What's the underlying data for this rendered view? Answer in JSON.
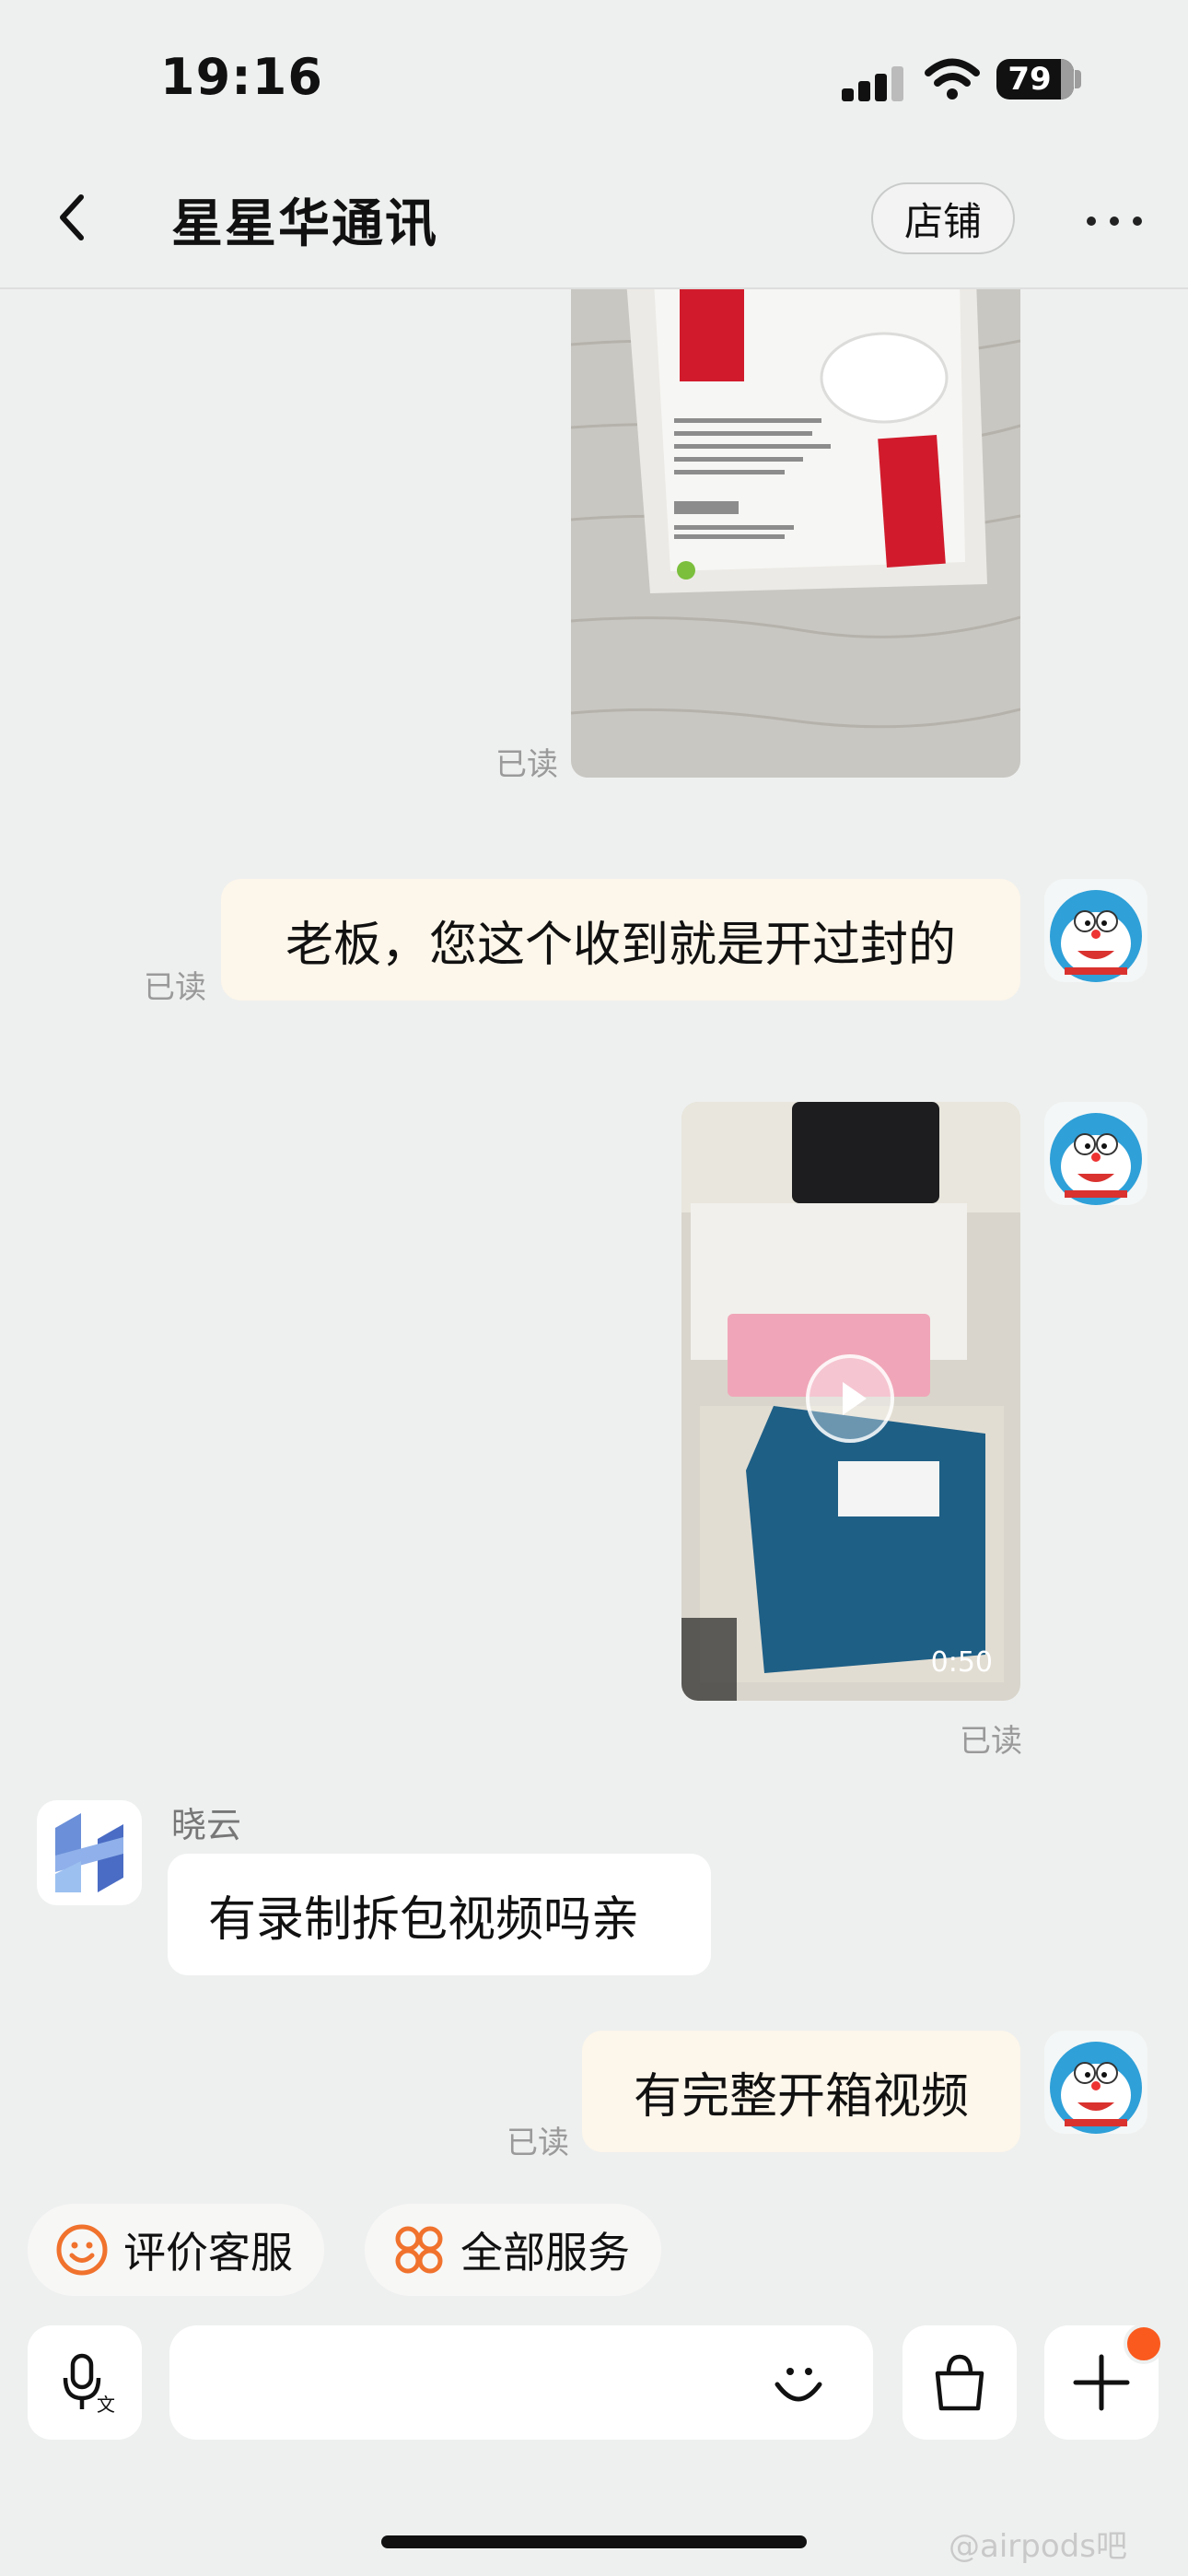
{
  "status_bar": {
    "time": "19:16",
    "battery": "79"
  },
  "nav": {
    "title": "星星华通讯",
    "shop_button": "店铺"
  },
  "messages": {
    "photo": {
      "read_status": "已读"
    },
    "text1": {
      "text": "老板，您这个收到就是开过封的",
      "read_status": "已读"
    },
    "video": {
      "duration": "0:50",
      "read_status": "已读"
    },
    "reply": {
      "sender": "晓云",
      "text": "有录制拆包视频吗亲"
    },
    "text2": {
      "text": "有完整开箱视频",
      "read_status": "已读"
    }
  },
  "quick_actions": {
    "rate": "评价客服",
    "all_services": "全部服务"
  },
  "input_bar": {
    "placeholder": ""
  },
  "watermark": "@airpods吧",
  "colors": {
    "accent": "#fa5a1e",
    "outgoing_bubble": "#fdf6ea",
    "background": "#eef0ef"
  }
}
